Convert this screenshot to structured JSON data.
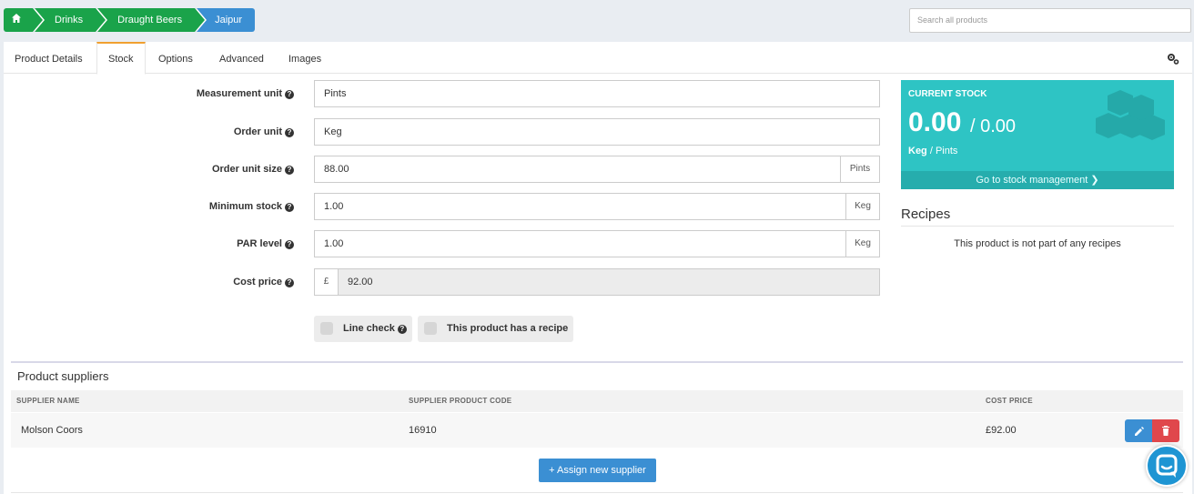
{
  "breadcrumb": {
    "home_icon": "home-icon",
    "items": [
      "Drinks",
      "Draught Beers",
      "Jaipur"
    ]
  },
  "search": {
    "placeholder": "Search all products"
  },
  "tabs": [
    "Product Details",
    "Stock",
    "Options",
    "Advanced",
    "Images"
  ],
  "active_tab": "Stock",
  "form": {
    "measurement_unit": {
      "label": "Measurement unit",
      "value": "Pints"
    },
    "order_unit": {
      "label": "Order unit",
      "value": "Keg"
    },
    "order_unit_size": {
      "label": "Order unit size",
      "value": "88.00",
      "addon": "Pints"
    },
    "minimum_stock": {
      "label": "Minimum stock",
      "value": "1.00",
      "addon": "Keg"
    },
    "par_level": {
      "label": "PAR level",
      "value": "1.00",
      "addon": "Keg"
    },
    "cost_price": {
      "label": "Cost price",
      "currency": "£",
      "value": "92.00"
    },
    "line_check": "Line check",
    "has_recipe": "This product has a recipe",
    "help_glyph": "?"
  },
  "stock_card": {
    "title": "CURRENT STOCK",
    "current": "0.00",
    "total": "/ 0.00",
    "unit_primary": "Keg",
    "unit_secondary": "/ Pints",
    "link": "Go to stock management ❯"
  },
  "recipes": {
    "title": "Recipes",
    "empty_text": "This product is not part of any recipes"
  },
  "suppliers": {
    "title": "Product suppliers",
    "columns": [
      "SUPPLIER NAME",
      "SUPPLIER PRODUCT CODE",
      "COST PRICE"
    ],
    "rows": [
      {
        "name": "Molson Coors",
        "code": "16910",
        "cost": "£92.00"
      }
    ],
    "assign_label": "+ Assign new supplier"
  },
  "colors": {
    "breadcrumb_green": "#1aa34a",
    "breadcrumb_active": "#3b8fd3",
    "stock_teal": "#2ec4c4",
    "tab_accent": "#f0a030",
    "delete_red": "#e0474c"
  }
}
